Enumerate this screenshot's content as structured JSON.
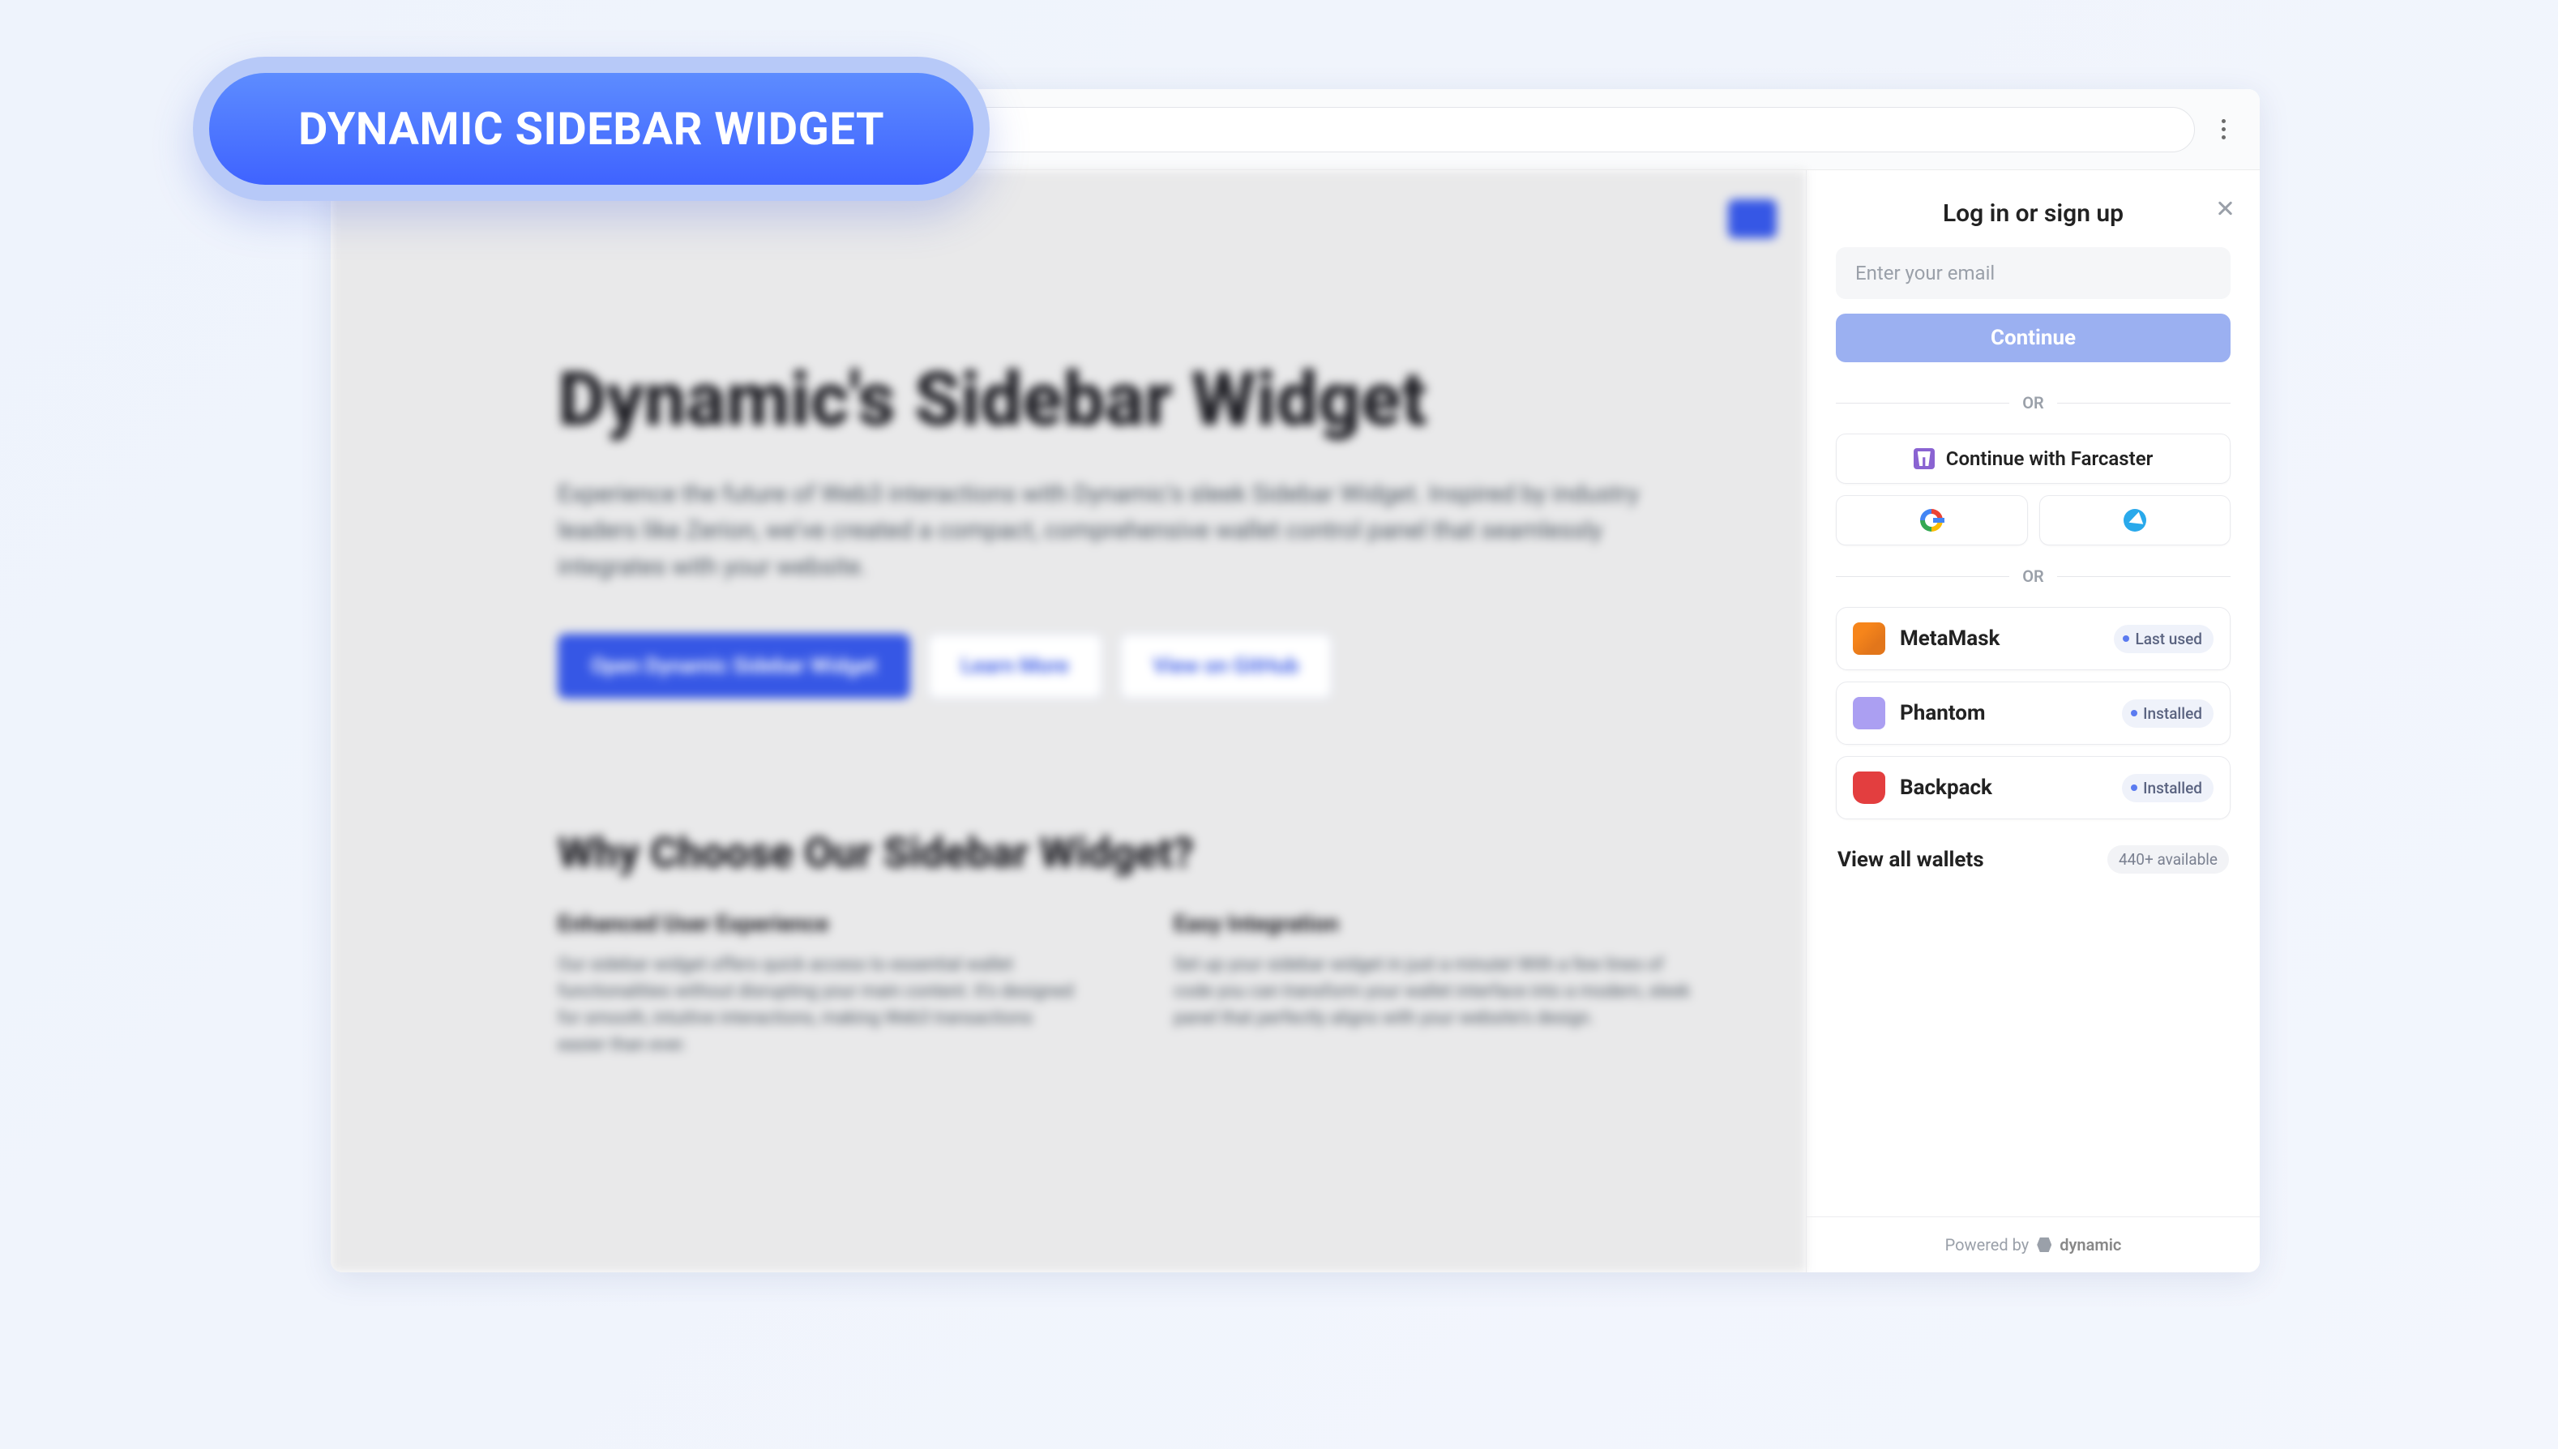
{
  "pill": "DYNAMIC SIDEBAR WIDGET",
  "page": {
    "title": "Dynamic's Sidebar Widget",
    "description": "Experience the future of Web3 interactions with Dynamic's sleek Sidebar Widget. Inspired by industry leaders like Zerion, we've created a compact, comprehensive wallet control panel that seamlessly integrates with your website.",
    "btn_primary": "Open Dynamic Sidebar Widget",
    "btn_learn": "Learn More",
    "btn_github": "View on GitHub",
    "section_title": "Why Choose Our Sidebar Widget?",
    "feature1_title": "Enhanced User Experience",
    "feature1_desc": "Our sidebar widget offers quick access to essential wallet functionalities without disrupting your main content. It's designed for smooth, intuitive interactions, making Web3 transactions easier than ever.",
    "feature2_title": "Easy Integration",
    "feature2_desc": "Set up your sidebar widget in just a minute! With a few lines of code you can transform your wallet interface into a modern, sleek panel that perfectly aligns with your website's design."
  },
  "sidebar": {
    "title": "Log in or sign up",
    "email_placeholder": "Enter your email",
    "continue": "Continue",
    "or": "OR",
    "farcaster": "Continue with Farcaster",
    "wallets": [
      {
        "name": "MetaMask",
        "badge": "Last used"
      },
      {
        "name": "Phantom",
        "badge": "Installed"
      },
      {
        "name": "Backpack",
        "badge": "Installed"
      }
    ],
    "view_all": "View all wallets",
    "available": "440+ available",
    "powered_by": "Powered by",
    "brand": "dynamic"
  }
}
